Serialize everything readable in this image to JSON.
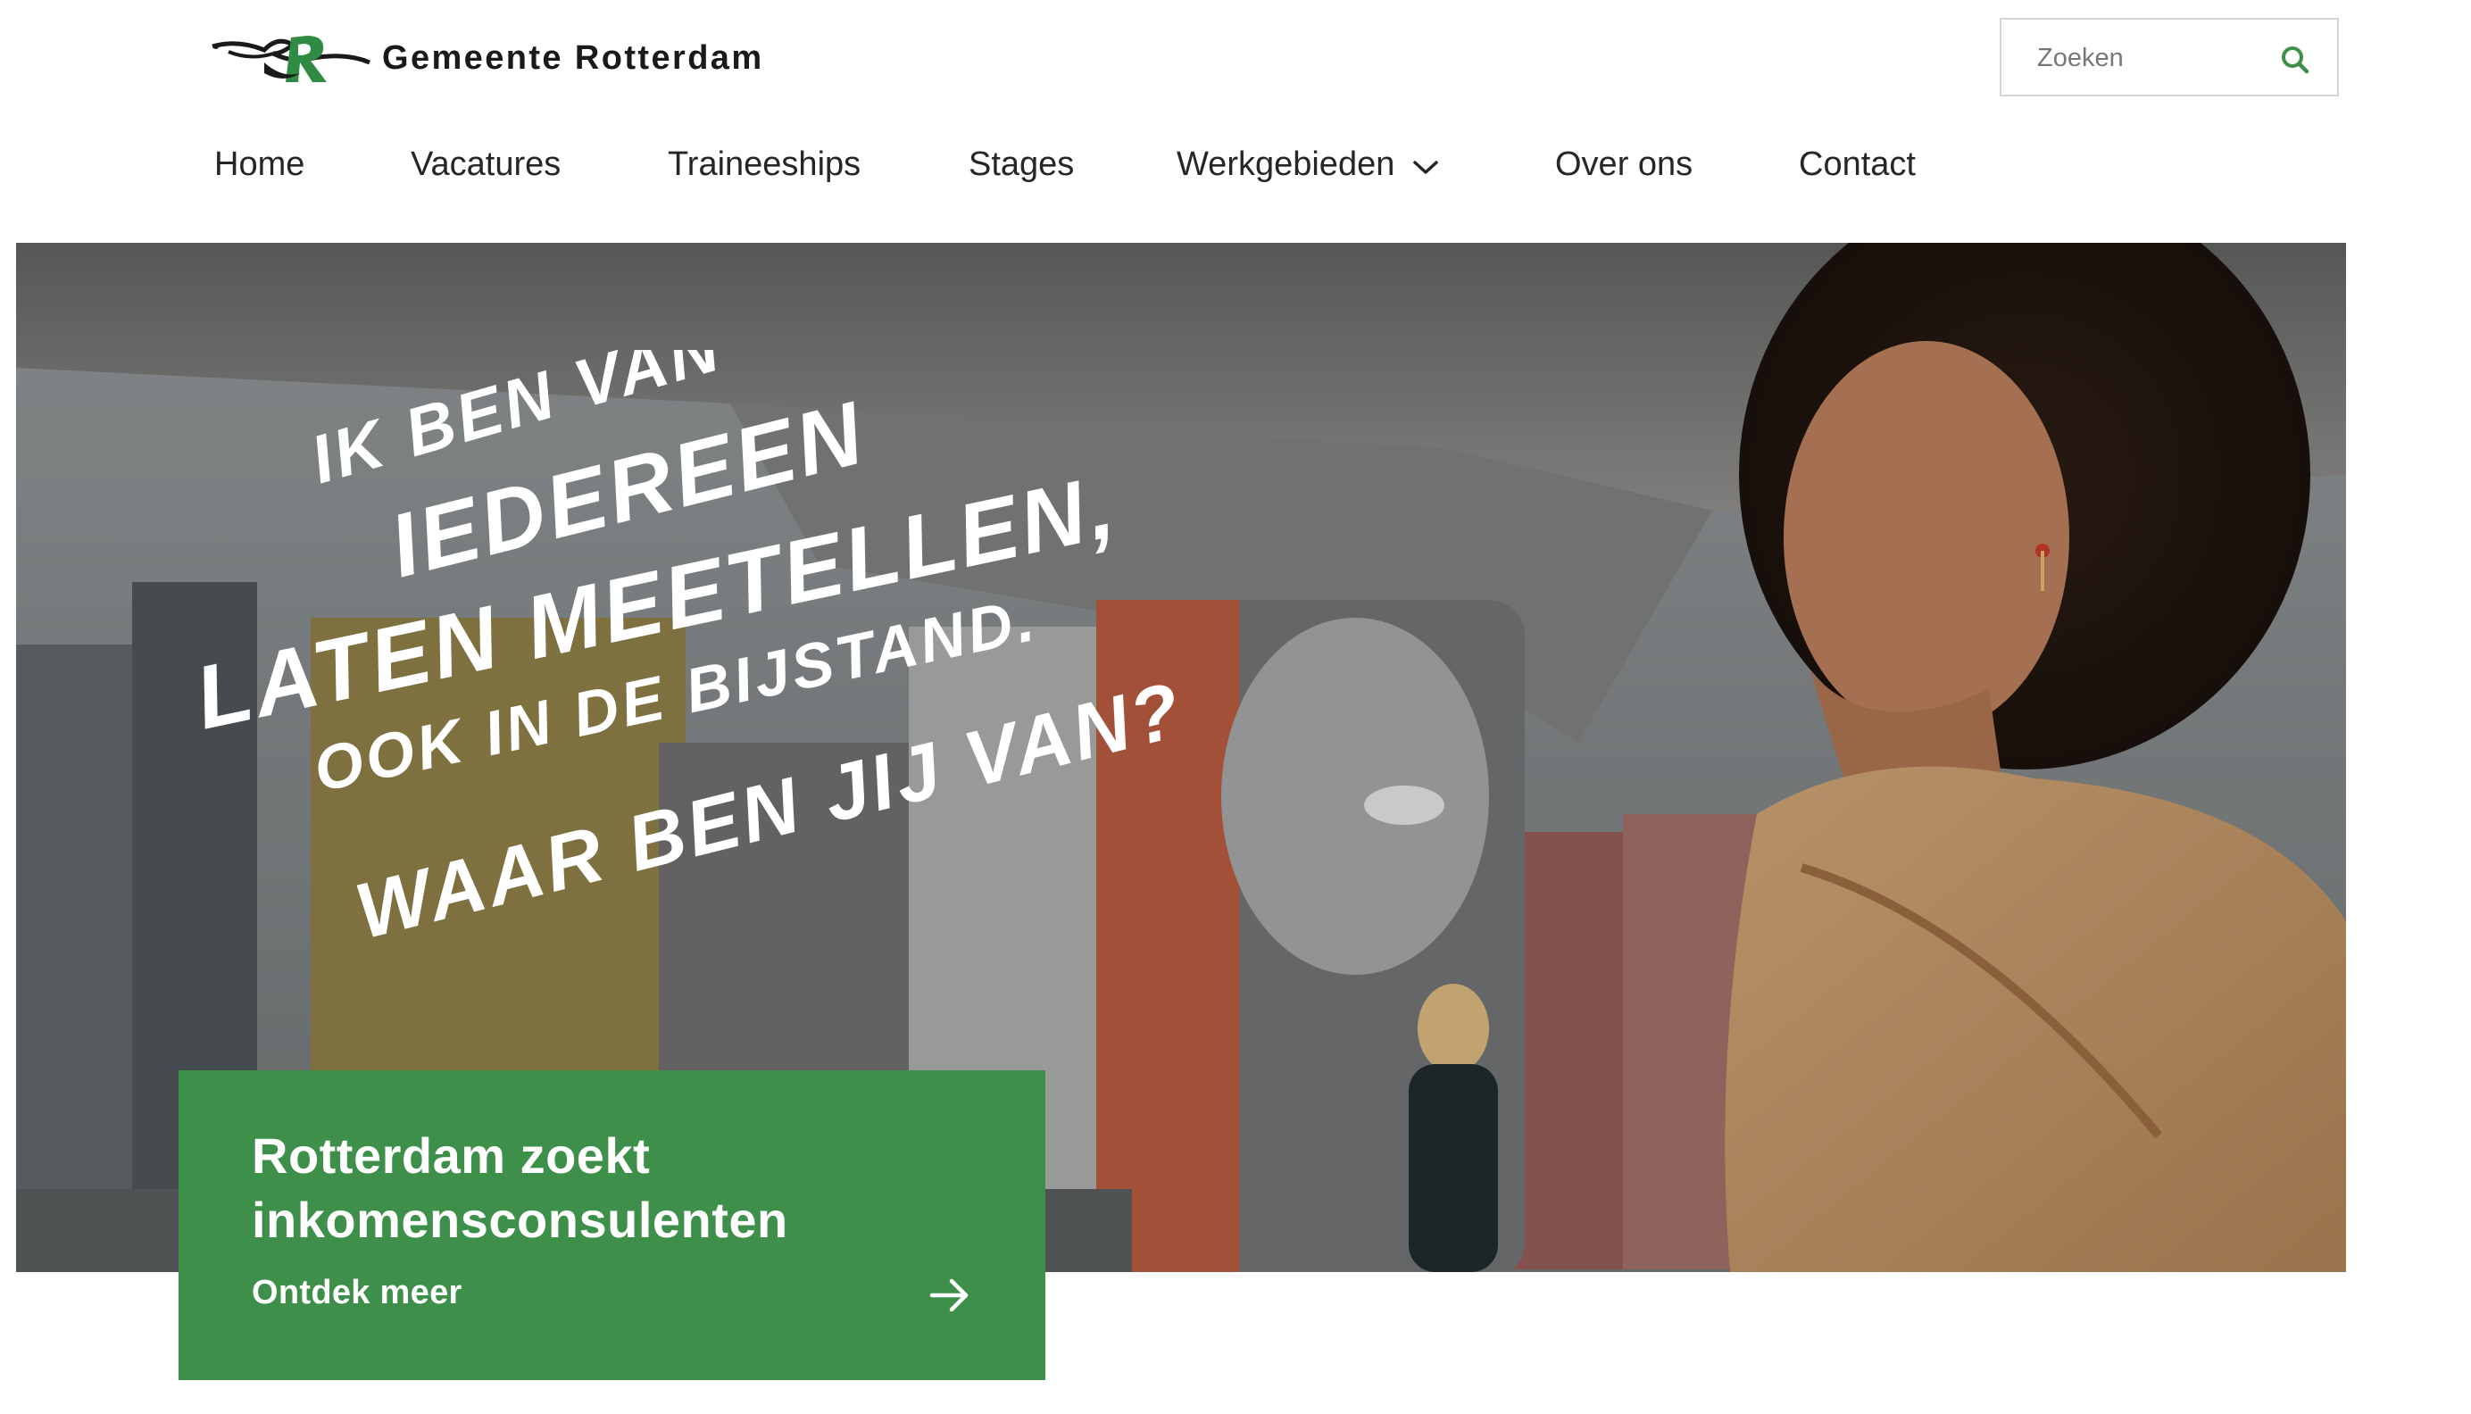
{
  "brand": {
    "name": "Gemeente Rotterdam",
    "accent_color": "#3e8f4a"
  },
  "search": {
    "placeholder": "Zoeken",
    "icon": "search-icon"
  },
  "nav": {
    "items": [
      {
        "label": "Home"
      },
      {
        "label": "Vacatures"
      },
      {
        "label": "Traineeships"
      },
      {
        "label": "Stages"
      },
      {
        "label": "Werkgebieden",
        "icon": "chevron-down-icon"
      },
      {
        "label": "Over ons"
      },
      {
        "label": "Contact"
      }
    ]
  },
  "hero": {
    "slogan_lines": [
      "IK BEN VAN",
      "IEDEREEN",
      "LATEN MEETELLEN,",
      "OOK IN DE BIJSTAND.",
      "WAAR BEN JIJ VAN?"
    ]
  },
  "promo": {
    "title_line1": "Rotterdam zoekt",
    "title_line2": "inkomensconsulenten",
    "link_label": "Ontdek meer",
    "icon": "arrow-right-icon"
  }
}
